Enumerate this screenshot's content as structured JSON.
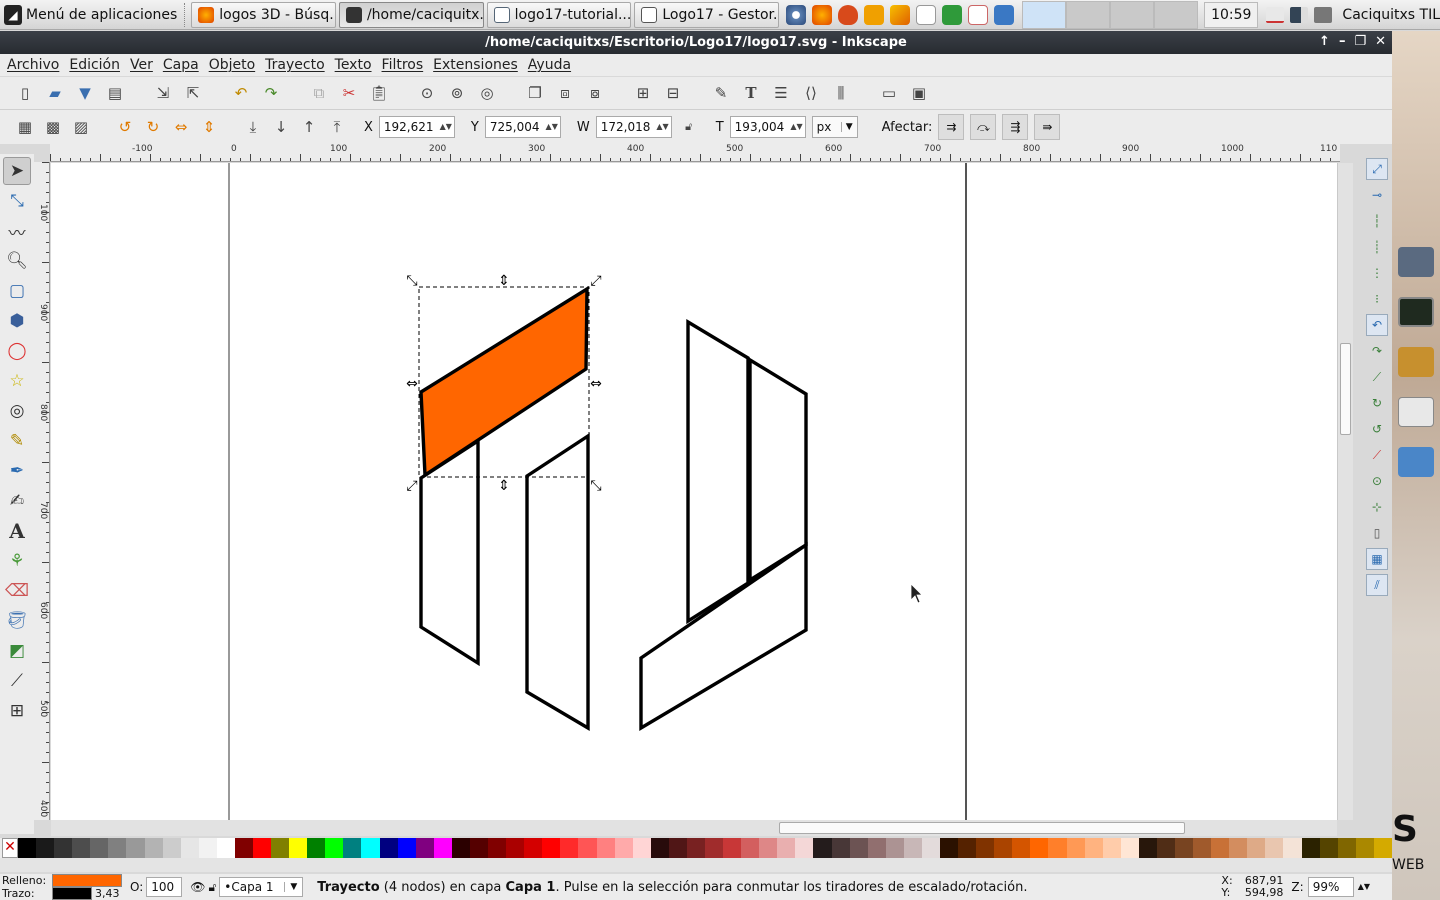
{
  "panel": {
    "app_menu": "Menú de aplicaciones",
    "tasks": [
      {
        "label": "logos 3D - Búsq...",
        "icon": "firefox-icon",
        "active": false
      },
      {
        "label": "/home/caciquitx...",
        "icon": "inkscape-icon",
        "active": true
      },
      {
        "label": "logo17-tutorial....",
        "icon": "document-icon",
        "active": false
      },
      {
        "label": "Logo17 - Gestor...",
        "icon": "folder-icon",
        "active": false
      }
    ],
    "clock": "10:59",
    "user": "Caciquitxs TIL"
  },
  "window": {
    "title": "/home/caciquitxs/Escritorio/Logo17/logo17.svg - Inkscape",
    "controls": [
      "↑",
      "–",
      "❐",
      "✕"
    ]
  },
  "menubar": [
    "Archivo",
    "Edición",
    "Ver",
    "Capa",
    "Objeto",
    "Trayecto",
    "Texto",
    "Filtros",
    "Extensiones",
    "Ayuda"
  ],
  "controls": {
    "x_label": "X",
    "x_value": "192,621",
    "y_label": "Y",
    "y_value": "725,004",
    "w_label": "W",
    "w_value": "172,018",
    "h_label": "T",
    "h_value": "193,004",
    "unit": "px",
    "affect_label": "Afectar:"
  },
  "hruler_labels": [
    "-100",
    "0",
    "100",
    "200",
    "300",
    "400",
    "500",
    "600",
    "700",
    "800",
    "900",
    "1000",
    "110"
  ],
  "vruler_labels": [
    "100",
    "900",
    "800",
    "700",
    "600",
    "500",
    "400"
  ],
  "shapes": {
    "selected_fill": "#ff6600",
    "stroke": "#000000"
  },
  "palette": [
    "#000000",
    "#1a1a1a",
    "#333333",
    "#4d4d4d",
    "#666666",
    "#808080",
    "#999999",
    "#b3b3b3",
    "#cccccc",
    "#e6e6e6",
    "#f2f2f2",
    "#ffffff",
    "#800000",
    "#ff0000",
    "#808000",
    "#ffff00",
    "#008000",
    "#00ff00",
    "#008080",
    "#00ffff",
    "#000080",
    "#0000ff",
    "#800080",
    "#ff00ff",
    "#2b0000",
    "#550000",
    "#800000",
    "#aa0000",
    "#d40000",
    "#ff0000",
    "#ff2a2a",
    "#ff5555",
    "#ff8080",
    "#ffaaaa",
    "#ffd5d5",
    "#280b0b",
    "#501616",
    "#782121",
    "#a02c2c",
    "#c83737",
    "#d35f5f",
    "#de8787",
    "#e9afaf",
    "#f4d7d7",
    "#241c1c",
    "#483737",
    "#6c5353",
    "#916f6f",
    "#ac9393",
    "#c8b7b7",
    "#e3dbdb",
    "#2b1100",
    "#552200",
    "#803300",
    "#aa4400",
    "#d45500",
    "#ff6600",
    "#ff7f2a",
    "#ff9955",
    "#ffb380",
    "#ffccaa",
    "#ffe6d5",
    "#28170b",
    "#502d16",
    "#784421",
    "#a05a2c",
    "#c87137",
    "#d38d5f",
    "#deaa87",
    "#e9c6af",
    "#f4e3d7",
    "#2b2200",
    "#554400",
    "#806600",
    "#aa8800",
    "#d4aa00"
  ],
  "status": {
    "fill_label": "Relleno:",
    "stroke_label": "Trazo:",
    "fill_color": "#ff6600",
    "stroke_color": "#000000",
    "stroke_width": "3,43",
    "opacity_label": "O:",
    "opacity_value": "100",
    "layer": "•Capa 1",
    "message_bold": "Trayecto",
    "message_mid": " (4 nodos) en capa ",
    "message_bold2": "Capa 1",
    "message_end": ". Pulse en la selección para conmutar los tiradores de escalado/rotación.",
    "x_label": "X:",
    "x": "687,91",
    "y_label": "Y:",
    "y": "594,98",
    "zoom_label": "Z:",
    "zoom": "99%"
  },
  "side": {
    "big_letter": "S",
    "small_text": "WEB"
  }
}
